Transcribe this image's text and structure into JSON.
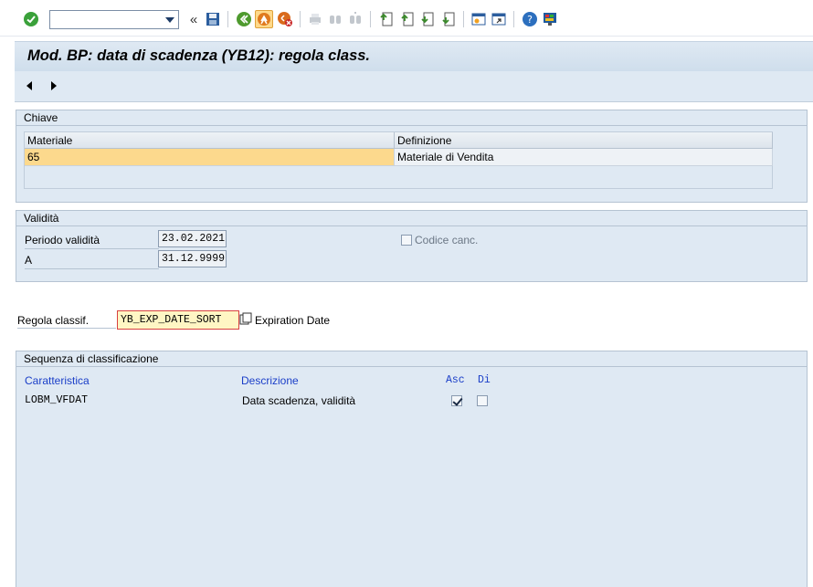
{
  "toolbar": {
    "command_value": "",
    "buttons": [
      "enter",
      "save",
      "back",
      "exit",
      "cancel",
      "print",
      "find",
      "find-next",
      "first-page",
      "previous-page",
      "next-page",
      "last-page",
      "new-session",
      "shortcut",
      "help",
      "customize"
    ]
  },
  "title": "Mod. BP: data di scadenza (YB12): regola class.",
  "chiave": {
    "header": "Chiave",
    "col_materiale": "Materiale",
    "col_definizione": "Definizione",
    "row_materiale": "65",
    "row_definizione": "Materiale di Vendita"
  },
  "validita": {
    "header": "Validità",
    "periodo_label": "Periodo validità",
    "periodo_value": "23.02.2021",
    "a_label": "A",
    "a_value": "31.12.9999",
    "codice_label": "Codice canc."
  },
  "regola": {
    "label": "Regola classif.",
    "value": "YB_EXP_DATE_SORT",
    "description": "Expiration Date"
  },
  "sequenza": {
    "header": "Sequenza di classificazione",
    "col_caratteristica": "Caratteristica",
    "col_descrizione": "Descrizione",
    "col_asc": "Asc",
    "col_di": "Di",
    "rows": [
      {
        "caratteristica": "LOBM_VFDAT",
        "descrizione": "Data scadenza, validità",
        "asc": true,
        "di": false
      }
    ]
  }
}
